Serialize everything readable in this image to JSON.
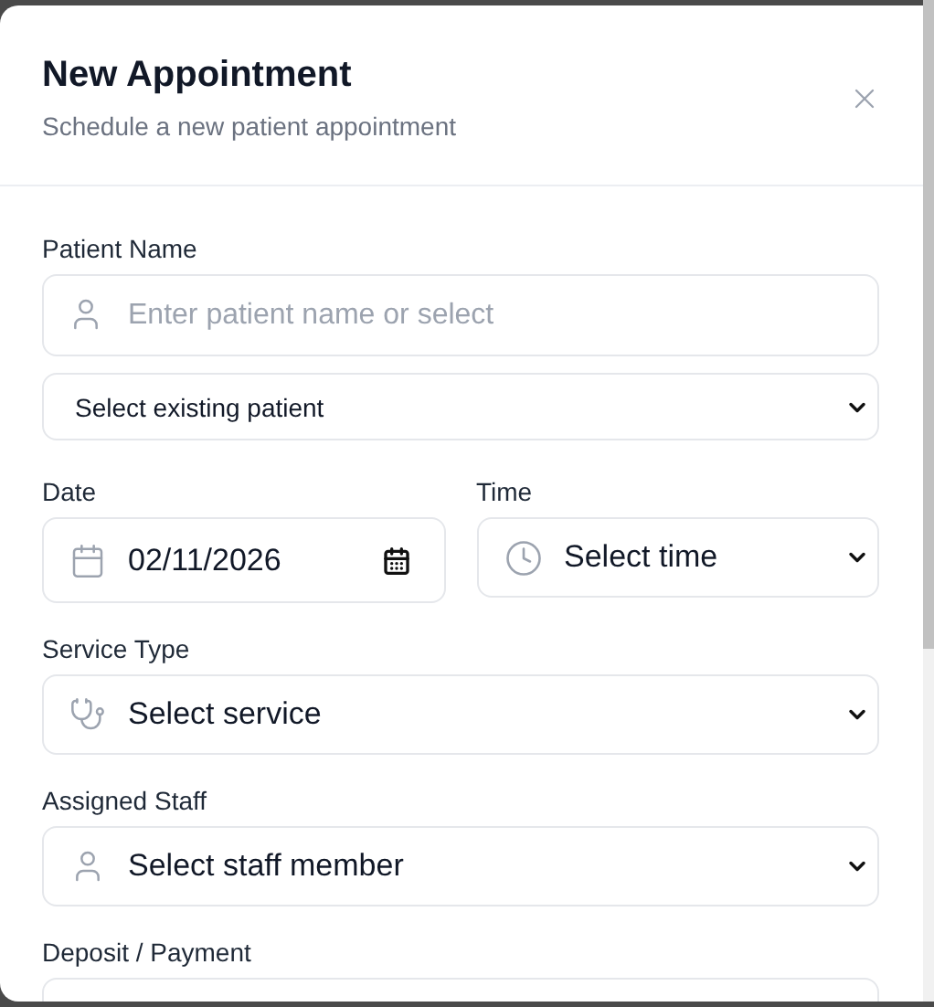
{
  "dialog": {
    "title": "New Appointment",
    "subtitle": "Schedule a new patient appointment"
  },
  "patient": {
    "label": "Patient Name",
    "input": {
      "placeholder": "Enter patient name or select"
    },
    "existing_select": {
      "value": "Select existing patient"
    }
  },
  "date": {
    "label": "Date",
    "value": "02/11/2026"
  },
  "time": {
    "label": "Time",
    "value": "Select time"
  },
  "fields": [
    {
      "label": "Service Type",
      "value": "Select service",
      "kind": "service"
    },
    {
      "label": "Assigned Staff",
      "value": "Select staff member",
      "kind": "staff"
    }
  ],
  "deposit": {
    "label": "Deposit / Payment"
  }
}
